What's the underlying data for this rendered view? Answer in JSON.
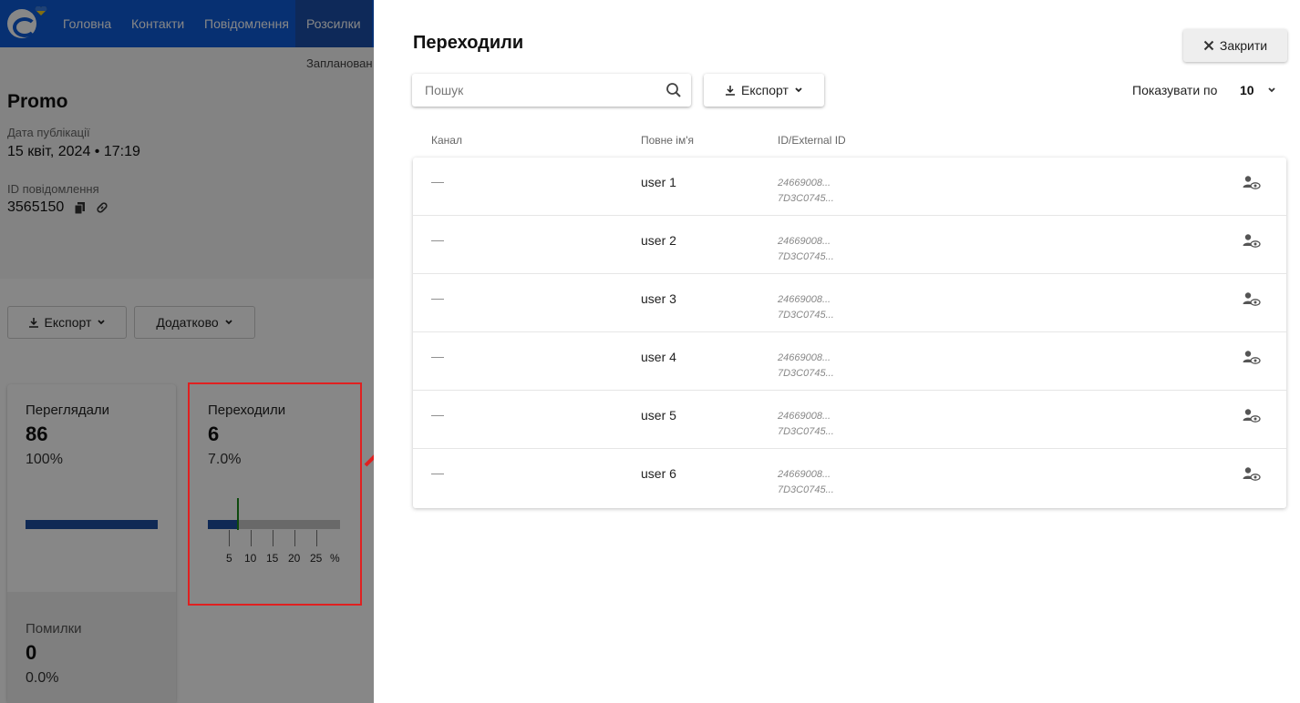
{
  "background": {
    "nav": {
      "items": [
        "Головна",
        "Контакти",
        "Повідомлення",
        "Розсилки"
      ]
    },
    "scheduled_text": "Запланован",
    "message": {
      "title": "Promo",
      "date_label": "Дата публікації",
      "date_value": "15 квіт, 2024 • 17:19",
      "id_label": "ID повідомлення",
      "id_value": "3565150"
    },
    "buttons": {
      "export": "Експорт",
      "more": "Додатково"
    },
    "stats": [
      {
        "label": "Переглядали",
        "count": "86",
        "percent": "100%",
        "fill": 1.0
      },
      {
        "label": "Переходили",
        "count": "6",
        "percent": "7.0%",
        "fill": 0.07,
        "ticks": [
          "5",
          "10",
          "15",
          "20",
          "25",
          "%"
        ]
      }
    ],
    "errors": {
      "label": "Помилки",
      "count": "0",
      "percent": "0.0%"
    }
  },
  "panel": {
    "title": "Переходили",
    "close_label": "Закрити",
    "search_placeholder": "Пошук",
    "export_label": "Експорт",
    "per_page_label": "Показувати по",
    "per_page_value": "10",
    "columns": {
      "channel": "Канал",
      "full_name": "Повне ім'я",
      "id": "ID/External ID"
    },
    "rows": [
      {
        "channel": "—",
        "name": "user 1",
        "id": "24669008...",
        "external_id": "7D3C0745..."
      },
      {
        "channel": "—",
        "name": "user 2",
        "id": "24669008...",
        "external_id": "7D3C0745..."
      },
      {
        "channel": "—",
        "name": "user 3",
        "id": "24669008...",
        "external_id": "7D3C0745..."
      },
      {
        "channel": "—",
        "name": "user 4",
        "id": "24669008...",
        "external_id": "7D3C0745..."
      },
      {
        "channel": "—",
        "name": "user 5",
        "id": "24669008...",
        "external_id": "7D3C0745..."
      },
      {
        "channel": "—",
        "name": "user 6",
        "id": "24669008...",
        "external_id": "7D3C0745..."
      }
    ]
  },
  "colors": {
    "nav_blue": "#0f5bd8",
    "bar_blue": "#1e4fa0",
    "marker_green": "#1a8a1a",
    "highlight_red": "#e02020"
  }
}
